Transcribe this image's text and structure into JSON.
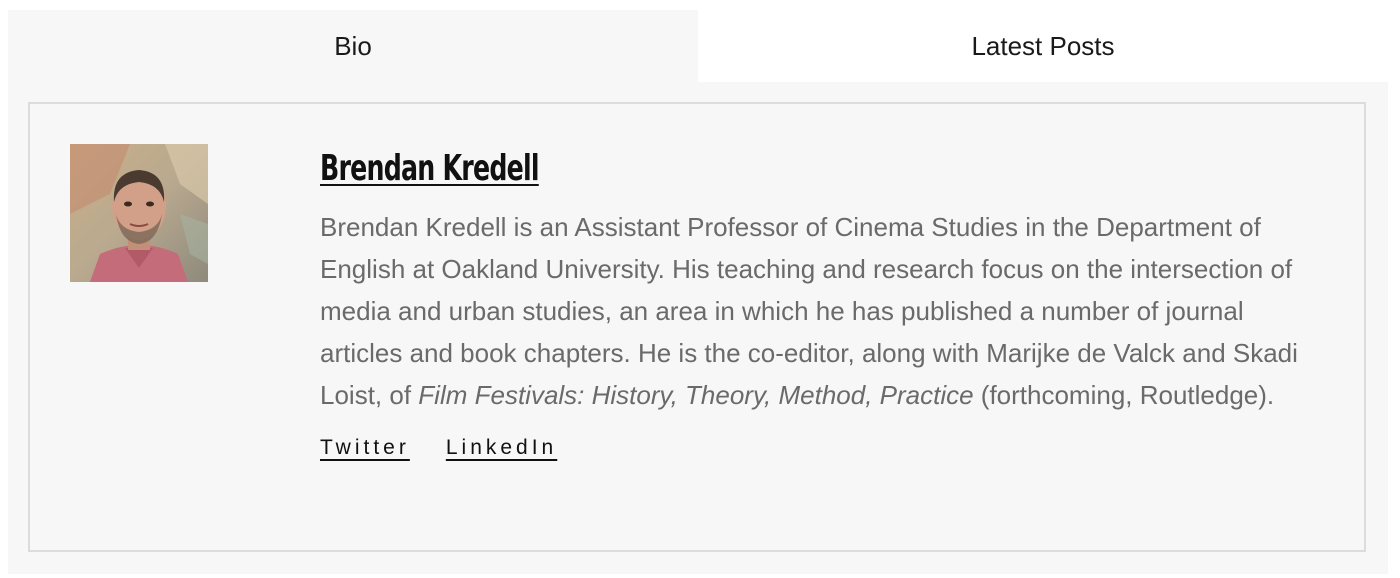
{
  "tabs": [
    {
      "label": "Bio",
      "active": true
    },
    {
      "label": "Latest Posts",
      "active": false
    }
  ],
  "author": {
    "name": "Brendan Kredell",
    "avatar_alt": "avatar-photo",
    "bio_part1": "Brendan Kredell is an Assistant Professor of Cinema Studies in the Department of English at Oakland University. His teaching and research focus on the intersection of media and urban studies, an area in which he has published a number of journal articles and book chapters. He is the co-editor, along with Marijke de Valck and Skadi Loist, of ",
    "bio_book_title": "Film Festivals: History, Theory, Method, Practice",
    "bio_part2": " (forthcoming, Routledge)."
  },
  "social_links": [
    {
      "label": "Twitter"
    },
    {
      "label": "LinkedIn"
    }
  ],
  "colors": {
    "panel_background": "#f7f7f7",
    "border": "#dcdcdc",
    "bio_text": "#6a6a6a",
    "heading_text": "#111111"
  }
}
